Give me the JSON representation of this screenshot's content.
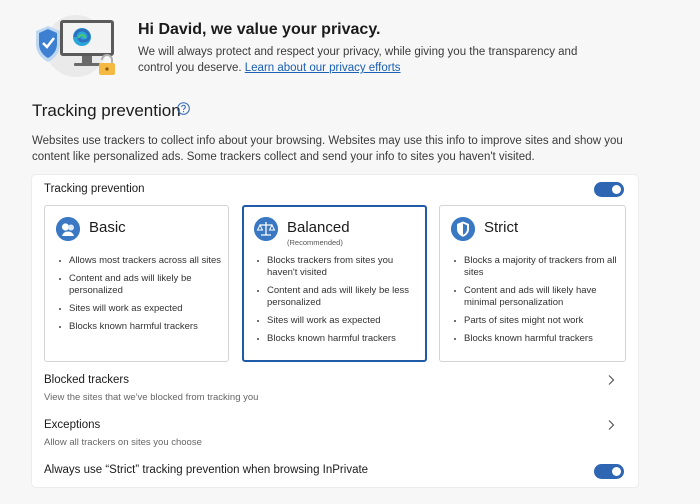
{
  "hero": {
    "greeting": "Hi David, we value your privacy.",
    "text": "We will always protect and respect your privacy, while giving you the transparency and control you deserve.",
    "link": "Learn about our privacy efforts"
  },
  "tracking": {
    "title": "Tracking prevention",
    "help_icon": "question-circle-icon",
    "description": "Websites use trackers to collect info about your browsing. Websites may use this info to improve sites and show you content like personalized ads. Some trackers collect and send your info to sites you haven't visited.",
    "card_heading": "Tracking prevention",
    "enabled": true,
    "selected": "Balanced",
    "options": [
      {
        "title": "Basic",
        "subtitle": "",
        "icon": "basic-icon",
        "bullets": [
          "Allows most trackers across all sites",
          "Content and ads will likely be personalized",
          "Sites will work as expected",
          "Blocks known harmful trackers"
        ]
      },
      {
        "title": "Balanced",
        "subtitle": "(Recommended)",
        "icon": "scales-icon",
        "bullets": [
          "Blocks trackers from sites you haven't visited",
          "Content and ads will likely be less personalized",
          "Sites will work as expected",
          "Blocks known harmful trackers"
        ]
      },
      {
        "title": "Strict",
        "subtitle": "",
        "icon": "shield-icon",
        "bullets": [
          "Blocks a majority of trackers from all sites",
          "Content and ads will likely have minimal personalization",
          "Parts of sites might not work",
          "Blocks known harmful trackers"
        ]
      }
    ],
    "blocked": {
      "title": "Blocked trackers",
      "subtitle": "View the sites that we've blocked from tracking you"
    },
    "exceptions": {
      "title": "Exceptions",
      "subtitle": "Allow all trackers on sites you choose"
    },
    "inprivate": {
      "label": "Always use “Strict” tracking prevention when browsing InPrivate",
      "enabled": true
    }
  },
  "colors": {
    "accent": "#2f66b3",
    "selected_border": "#1f5ba6",
    "link": "#1a5fb4"
  }
}
